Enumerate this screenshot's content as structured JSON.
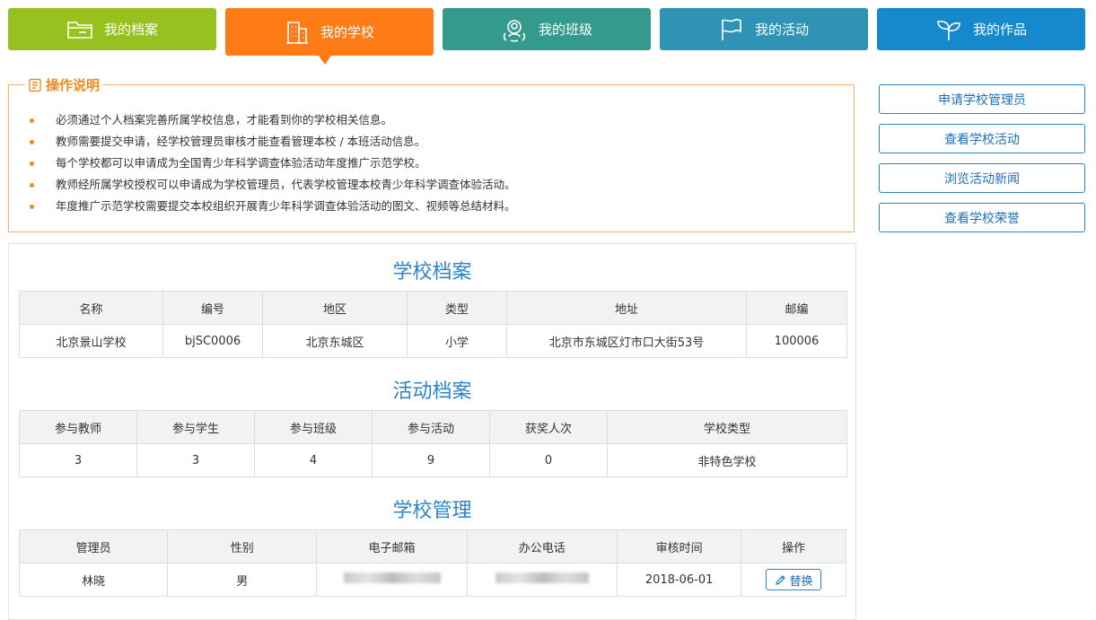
{
  "tabs": [
    {
      "label": "我的档案",
      "icon": "folder-icon",
      "color": "#96c11f"
    },
    {
      "label": "我的学校",
      "icon": "building-icon",
      "color": "#fe7b16",
      "active": true
    },
    {
      "label": "我的班级",
      "icon": "class-group-icon",
      "color": "#339a8d"
    },
    {
      "label": "我的活动",
      "icon": "flag-icon",
      "color": "#2f93b5"
    },
    {
      "label": "我的作品",
      "icon": "sprout-icon",
      "color": "#1688cc"
    }
  ],
  "instructions": {
    "title": "操作说明",
    "items": [
      "必须通过个人档案完善所属学校信息，才能看到你的学校相关信息。",
      "教师需要提交申请，经学校管理员审核才能查看管理本校 / 本班活动信息。",
      "每个学校都可以申请成为全国青少年科学调查体验活动年度推广示范学校。",
      "教师经所属学校授权可以申请成为学校管理员，代表学校管理本校青少年科学调查体验活动。",
      "年度推广示范学校需要提交本校组织开展青少年科学调查体验活动的图文、视频等总结材料。"
    ]
  },
  "side_buttons": [
    "申请学校管理员",
    "查看学校活动",
    "浏览活动新闻",
    "查看学校荣誉"
  ],
  "school_profile": {
    "title": "学校档案",
    "headers": [
      "名称",
      "编号",
      "地区",
      "类型",
      "地址",
      "邮编"
    ],
    "row": [
      "北京景山学校",
      "bjSC0006",
      "北京东城区",
      "小学",
      "北京市东城区灯市口大街53号",
      "100006"
    ]
  },
  "activity_profile": {
    "title": "活动档案",
    "headers": [
      "参与教师",
      "参与学生",
      "参与班级",
      "参与活动",
      "获奖人次",
      "学校类型"
    ],
    "row": [
      "3",
      "3",
      "4",
      "9",
      "0",
      "非特色学校"
    ]
  },
  "school_admin": {
    "title": "学校管理",
    "headers": [
      "管理员",
      "性别",
      "电子邮箱",
      "办公电话",
      "审核时间",
      "操作"
    ],
    "row": {
      "name": "林晓",
      "gender": "男",
      "date": "2018-06-01",
      "action": "替换"
    }
  }
}
